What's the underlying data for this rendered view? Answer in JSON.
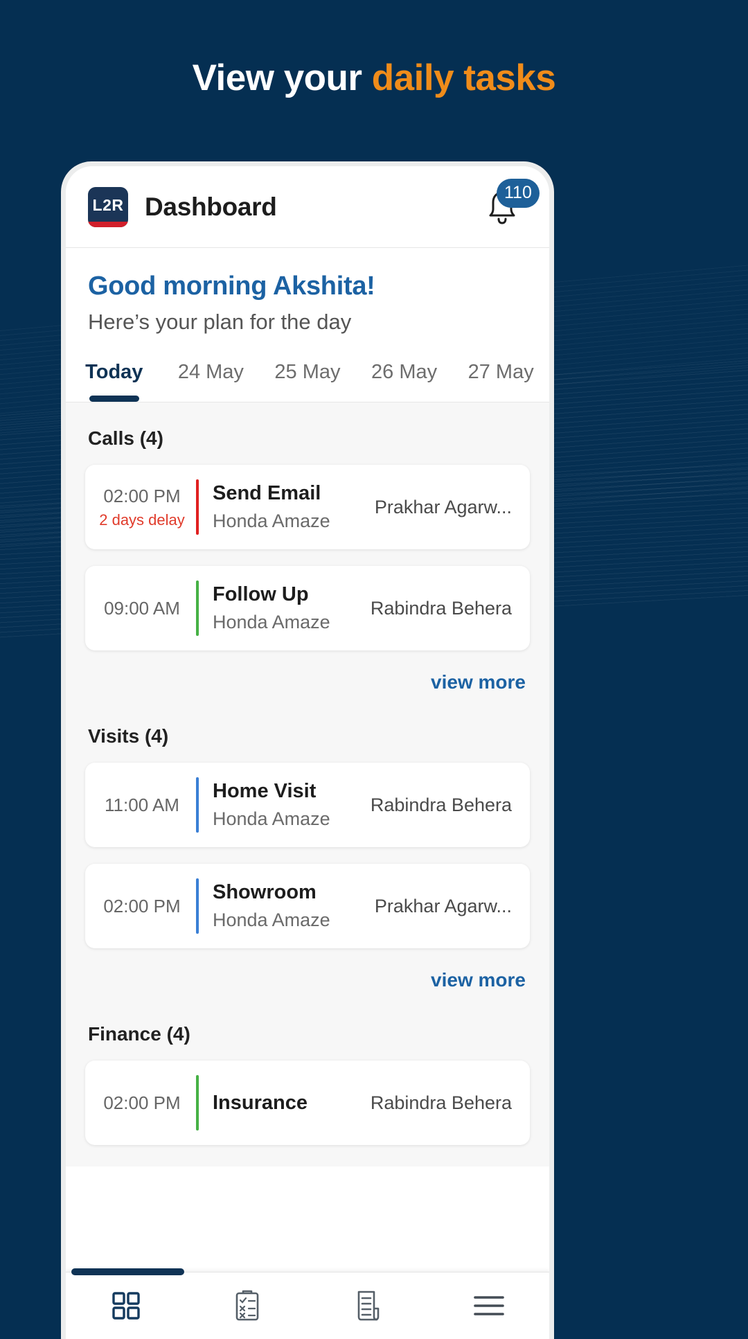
{
  "headline": {
    "text_plain": "View your ",
    "text_accent": "daily tasks",
    "accent_color": "#f08c1a"
  },
  "app_bar": {
    "logo_text": "L2R",
    "title": "Dashboard",
    "bell_icon": "bell-icon",
    "notification_count": "110",
    "badge_color": "#1e6099"
  },
  "greeting": {
    "title": "Good morning Akshita!",
    "subtitle": "Here’s your plan for the day",
    "title_color": "#1c62a3"
  },
  "date_tabs": [
    {
      "label": "Today",
      "active": true
    },
    {
      "label": "24 May",
      "active": false
    },
    {
      "label": "25 May",
      "active": false
    },
    {
      "label": "26 May",
      "active": false
    },
    {
      "label": "27 May",
      "active": false
    }
  ],
  "sections": [
    {
      "title": "Calls (4)",
      "view_more": "view more",
      "tasks": [
        {
          "time": "02:00 PM",
          "delay": "2 days delay",
          "accent": "#e02020",
          "name": "Send Email",
          "sub": "Honda Amaze",
          "person": "Prakhar Agarw..."
        },
        {
          "time": "09:00 AM",
          "delay": "",
          "accent": "#46b145",
          "name": "Follow Up",
          "sub": "Honda Amaze",
          "person": "Rabindra Behera"
        }
      ]
    },
    {
      "title": "Visits (4)",
      "view_more": "view more",
      "tasks": [
        {
          "time": "11:00 AM",
          "delay": "",
          "accent": "#3a7fd5",
          "name": "Home Visit",
          "sub": "Honda Amaze",
          "person": "Rabindra Behera"
        },
        {
          "time": "02:00 PM",
          "delay": "",
          "accent": "#3a7fd5",
          "name": "Showroom",
          "sub": "Honda Amaze",
          "person": "Prakhar Agarw..."
        }
      ]
    },
    {
      "title": "Finance (4)",
      "view_more": "",
      "tasks": [
        {
          "time": "02:00 PM",
          "delay": "",
          "accent": "#46b145",
          "name": "Insurance",
          "sub": "",
          "person": "Rabindra Behera"
        }
      ]
    }
  ],
  "bottom_nav": [
    {
      "icon": "grid-icon",
      "active": true
    },
    {
      "icon": "checklist-icon",
      "active": false
    },
    {
      "icon": "document-icon",
      "active": false
    },
    {
      "icon": "menu-icon",
      "active": false
    }
  ]
}
